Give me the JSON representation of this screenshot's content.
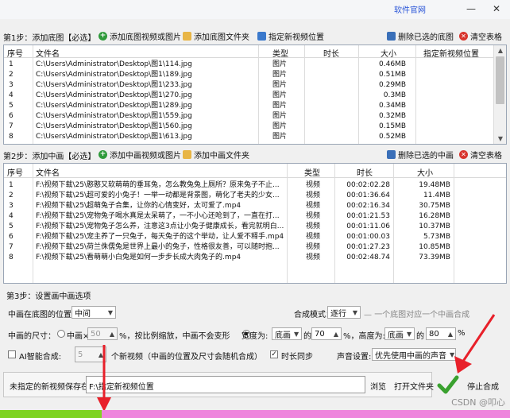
{
  "titlebar": {
    "official_link": "软件官网",
    "minimize": "—",
    "close": "✕"
  },
  "step1": {
    "label": "第1步：添加底图【必选】",
    "buttons": {
      "add_videos_images": "添加底图视频或图片",
      "add_folder": "添加底图文件夹",
      "set_position": "指定新视频位置",
      "delete_selected": "删除已选的底图",
      "clear_table": "清空表格"
    },
    "columns": [
      "序号",
      "文件名",
      "类型",
      "时长",
      "大小",
      "指定新视频位置"
    ],
    "rows": [
      [
        "1",
        "C:\\Users\\Administrator\\Desktop\\图1\\114.jpg",
        "图片",
        "",
        "0.46MB",
        ""
      ],
      [
        "2",
        "C:\\Users\\Administrator\\Desktop\\图1\\189.jpg",
        "图片",
        "",
        "0.51MB",
        ""
      ],
      [
        "3",
        "C:\\Users\\Administrator\\Desktop\\图1\\233.jpg",
        "图片",
        "",
        "0.29MB",
        ""
      ],
      [
        "4",
        "C:\\Users\\Administrator\\Desktop\\图1\\270.jpg",
        "图片",
        "",
        "0.3MB",
        ""
      ],
      [
        "5",
        "C:\\Users\\Administrator\\Desktop\\图1\\289.jpg",
        "图片",
        "",
        "0.34MB",
        ""
      ],
      [
        "6",
        "C:\\Users\\Administrator\\Desktop\\图1\\559.jpg",
        "图片",
        "",
        "0.32MB",
        ""
      ],
      [
        "7",
        "C:\\Users\\Administrator\\Desktop\\图1\\560.jpg",
        "图片",
        "",
        "0.15MB",
        ""
      ],
      [
        "8",
        "C:\\Users\\Administrator\\Desktop\\图1\\613.jpg",
        "图片",
        "",
        "0.52MB",
        ""
      ]
    ]
  },
  "step2": {
    "label": "第2步：添加中画【必选】",
    "buttons": {
      "add_videos_images": "添加中画视频或图片",
      "add_folder": "添加中画文件夹",
      "delete_selected": "删除已选的中画",
      "clear_table": "清空表格"
    },
    "columns": [
      "序号",
      "文件名",
      "类型",
      "时长",
      "大小"
    ],
    "rows": [
      [
        "1",
        "F:\\视频下载\\25\\憨憨又软萌萌的垂耳兔，怎么教兔兔上厕所？原来兔子不止...",
        "视频",
        "00:02:02.28",
        "19.48MB"
      ],
      [
        "2",
        "F:\\视频下载\\25\\超可爱的小兔子！一举一动都是背景图，萌化了老夫的少女...",
        "视频",
        "00:01:36.64",
        "11.4MB"
      ],
      [
        "3",
        "F:\\视频下载\\25\\超萌兔子合集，让你的心情变好，太可爱了.mp4",
        "视频",
        "00:02:16.34",
        "30.75MB"
      ],
      [
        "4",
        "F:\\视频下载\\25\\宠物兔子喝水真是太呆萌了，一不小心还呛到了，一直在打...",
        "视频",
        "00:01:21.53",
        "16.28MB"
      ],
      [
        "5",
        "F:\\视频下载\\25\\宠物兔子怎么养，注意这3点让小兔子健康成长，看完就明白...",
        "视频",
        "00:01:11.06",
        "10.37MB"
      ],
      [
        "6",
        "F:\\视频下载\\25\\宠主养了一只兔子，每天兔子的这个举动，让人爱不释手.mp4",
        "视频",
        "00:01:00.03",
        "5.73MB"
      ],
      [
        "7",
        "F:\\视频下载\\25\\荷兰侏儒兔是世界上最小的兔子，性格很友善，可以随时抱...",
        "视频",
        "00:01:27.23",
        "10.85MB"
      ],
      [
        "8",
        "F:\\视频下载\\25\\看萌萌小白兔是如何一步步长成大肉兔子的.mp4",
        "视频",
        "00:02:48.74",
        "73.39MB"
      ]
    ]
  },
  "step3": {
    "label": "第3步：设置画中画选项",
    "position_label": "中画在底图的位置：",
    "position_value": "中间",
    "compose_label": "合成模式：",
    "compose_value": "逐行",
    "compose_hint": "一个底图对应一个中画合成",
    "size_label": "中画的尺寸：",
    "size_radio1_prefix": "中画×",
    "size_percent_value": "50",
    "size_radio1_suffix": "%，按比例缩放，中画不会变形",
    "width_label": "宽度为:",
    "width_ref": "底画",
    "of1": "的",
    "width_value": "70",
    "height_label": "%，高度为:",
    "height_ref": "底画",
    "of2": "的",
    "height_value": "80",
    "pct": "%",
    "ai_label": "AI智能合成:",
    "ai_count": "5",
    "ai_hint": "个新视频（中画的位置及尺寸会随机合成）",
    "length_sync_label": "时长同步",
    "audio_label": "声音设置:",
    "audio_value": "优先使用中画的声音",
    "save_label": "未指定的新视频保存在:",
    "save_path": "F:\\指定新视频位置",
    "browse": "浏览",
    "open_folder": "打开文件夹",
    "stop_label": "停止合成"
  },
  "progress": {
    "percent": 20
  },
  "watermark": "CSDN @叩心",
  "colors": {
    "accent_link": "#2a55d8",
    "progress_fill": "#7ed321",
    "progress_track": "#ee86dd",
    "arrow": "#e8202a"
  }
}
